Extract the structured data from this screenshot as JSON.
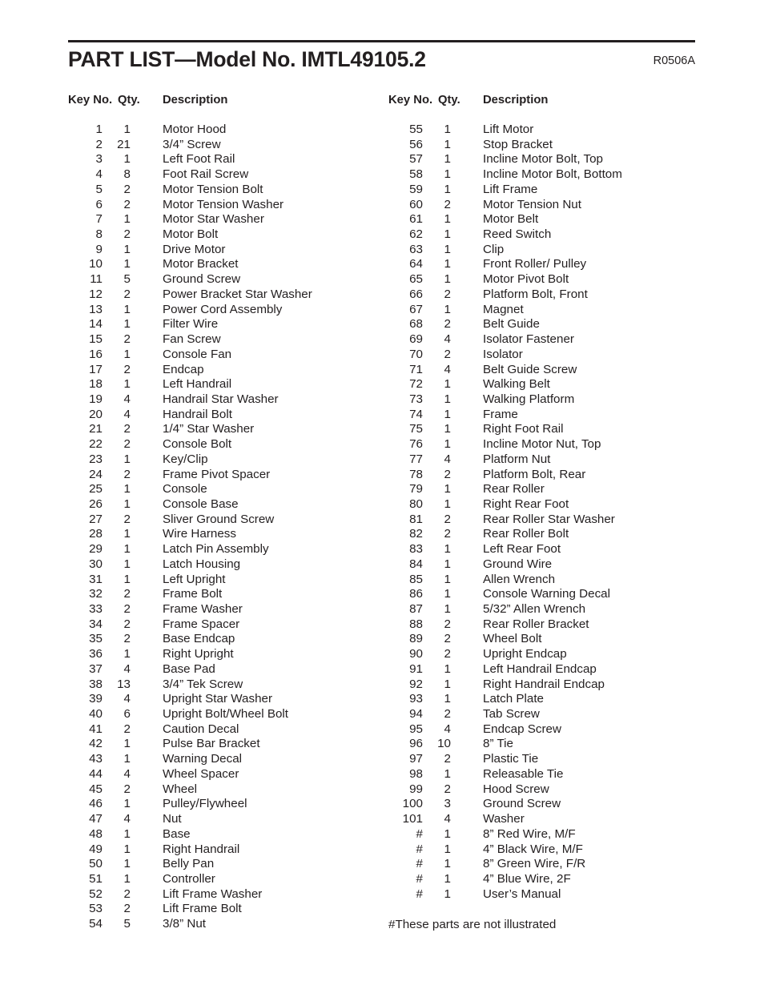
{
  "header": {
    "title": "PART LIST—Model No. IMTL49105.2",
    "revision": "R0506A"
  },
  "table": {
    "headers": {
      "key_no": "Key No.",
      "qty": "Qty.",
      "description": "Description"
    },
    "left_column": [
      {
        "key": "1",
        "qty": "1",
        "desc": "Motor Hood"
      },
      {
        "key": "2",
        "qty": "21",
        "desc": "3/4” Screw"
      },
      {
        "key": "3",
        "qty": "1",
        "desc": "Left Foot Rail"
      },
      {
        "key": "4",
        "qty": "8",
        "desc": "Foot Rail Screw"
      },
      {
        "key": "5",
        "qty": "2",
        "desc": "Motor Tension Bolt"
      },
      {
        "key": "6",
        "qty": "2",
        "desc": "Motor Tension Washer"
      },
      {
        "key": "7",
        "qty": "1",
        "desc": "Motor Star Washer"
      },
      {
        "key": "8",
        "qty": "2",
        "desc": "Motor Bolt"
      },
      {
        "key": "9",
        "qty": "1",
        "desc": "Drive Motor"
      },
      {
        "key": "10",
        "qty": "1",
        "desc": "Motor Bracket"
      },
      {
        "key": "11",
        "qty": "5",
        "desc": "Ground Screw"
      },
      {
        "key": "12",
        "qty": "2",
        "desc": "Power Bracket Star Washer"
      },
      {
        "key": "13",
        "qty": "1",
        "desc": "Power Cord Assembly"
      },
      {
        "key": "14",
        "qty": "1",
        "desc": "Filter Wire"
      },
      {
        "key": "15",
        "qty": "2",
        "desc": "Fan Screw"
      },
      {
        "key": "16",
        "qty": "1",
        "desc": "Console Fan"
      },
      {
        "key": "17",
        "qty": "2",
        "desc": "Endcap"
      },
      {
        "key": "18",
        "qty": "1",
        "desc": "Left Handrail"
      },
      {
        "key": "19",
        "qty": "4",
        "desc": "Handrail Star Washer"
      },
      {
        "key": "20",
        "qty": "4",
        "desc": "Handrail Bolt"
      },
      {
        "key": "21",
        "qty": "2",
        "desc": "1/4” Star Washer"
      },
      {
        "key": "22",
        "qty": "2",
        "desc": "Console Bolt"
      },
      {
        "key": "23",
        "qty": "1",
        "desc": "Key/Clip"
      },
      {
        "key": "24",
        "qty": "2",
        "desc": "Frame Pivot Spacer"
      },
      {
        "key": "25",
        "qty": "1",
        "desc": "Console"
      },
      {
        "key": "26",
        "qty": "1",
        "desc": "Console Base"
      },
      {
        "key": "27",
        "qty": "2",
        "desc": "Sliver Ground Screw"
      },
      {
        "key": "28",
        "qty": "1",
        "desc": "Wire Harness"
      },
      {
        "key": "29",
        "qty": "1",
        "desc": "Latch Pin Assembly"
      },
      {
        "key": "30",
        "qty": "1",
        "desc": "Latch Housing"
      },
      {
        "key": "31",
        "qty": "1",
        "desc": "Left Upright"
      },
      {
        "key": "32",
        "qty": "2",
        "desc": "Frame Bolt"
      },
      {
        "key": "33",
        "qty": "2",
        "desc": "Frame Washer"
      },
      {
        "key": "34",
        "qty": "2",
        "desc": "Frame Spacer"
      },
      {
        "key": "35",
        "qty": "2",
        "desc": "Base Endcap"
      },
      {
        "key": "36",
        "qty": "1",
        "desc": "Right Upright"
      },
      {
        "key": "37",
        "qty": "4",
        "desc": "Base Pad"
      },
      {
        "key": "38",
        "qty": "13",
        "desc": "3/4” Tek Screw"
      },
      {
        "key": "39",
        "qty": "4",
        "desc": "Upright Star Washer"
      },
      {
        "key": "40",
        "qty": "6",
        "desc": "Upright Bolt/Wheel Bolt"
      },
      {
        "key": "41",
        "qty": "2",
        "desc": "Caution Decal"
      },
      {
        "key": "42",
        "qty": "1",
        "desc": "Pulse Bar Bracket"
      },
      {
        "key": "43",
        "qty": "1",
        "desc": "Warning Decal"
      },
      {
        "key": "44",
        "qty": "4",
        "desc": "Wheel Spacer"
      },
      {
        "key": "45",
        "qty": "2",
        "desc": "Wheel"
      },
      {
        "key": "46",
        "qty": "1",
        "desc": "Pulley/Flywheel"
      },
      {
        "key": "47",
        "qty": "4",
        "desc": "Nut"
      },
      {
        "key": "48",
        "qty": "1",
        "desc": "Base"
      },
      {
        "key": "49",
        "qty": "1",
        "desc": "Right Handrail"
      },
      {
        "key": "50",
        "qty": "1",
        "desc": "Belly Pan"
      },
      {
        "key": "51",
        "qty": "1",
        "desc": "Controller"
      },
      {
        "key": "52",
        "qty": "2",
        "desc": "Lift Frame Washer"
      },
      {
        "key": "53",
        "qty": "2",
        "desc": "Lift Frame Bolt"
      },
      {
        "key": "54",
        "qty": "5",
        "desc": "3/8” Nut"
      }
    ],
    "right_column": [
      {
        "key": "55",
        "qty": "1",
        "desc": "Lift Motor"
      },
      {
        "key": "56",
        "qty": "1",
        "desc": "Stop Bracket"
      },
      {
        "key": "57",
        "qty": "1",
        "desc": "Incline Motor Bolt, Top"
      },
      {
        "key": "58",
        "qty": "1",
        "desc": "Incline Motor Bolt, Bottom"
      },
      {
        "key": "59",
        "qty": "1",
        "desc": "Lift Frame"
      },
      {
        "key": "60",
        "qty": "2",
        "desc": "Motor Tension Nut"
      },
      {
        "key": "61",
        "qty": "1",
        "desc": "Motor Belt"
      },
      {
        "key": "62",
        "qty": "1",
        "desc": "Reed Switch"
      },
      {
        "key": "63",
        "qty": "1",
        "desc": "Clip"
      },
      {
        "key": "64",
        "qty": "1",
        "desc": "Front Roller/ Pulley"
      },
      {
        "key": "65",
        "qty": "1",
        "desc": "Motor Pivot Bolt"
      },
      {
        "key": "66",
        "qty": "2",
        "desc": "Platform Bolt, Front"
      },
      {
        "key": "67",
        "qty": "1",
        "desc": "Magnet"
      },
      {
        "key": "68",
        "qty": "2",
        "desc": "Belt Guide"
      },
      {
        "key": "69",
        "qty": "4",
        "desc": "Isolator Fastener"
      },
      {
        "key": "70",
        "qty": "2",
        "desc": "Isolator"
      },
      {
        "key": "71",
        "qty": "4",
        "desc": "Belt Guide Screw"
      },
      {
        "key": "72",
        "qty": "1",
        "desc": "Walking Belt"
      },
      {
        "key": "73",
        "qty": "1",
        "desc": "Walking Platform"
      },
      {
        "key": "74",
        "qty": "1",
        "desc": "Frame"
      },
      {
        "key": "75",
        "qty": "1",
        "desc": "Right Foot Rail"
      },
      {
        "key": "76",
        "qty": "1",
        "desc": "Incline Motor Nut, Top"
      },
      {
        "key": "77",
        "qty": "4",
        "desc": "Platform Nut"
      },
      {
        "key": "78",
        "qty": "2",
        "desc": "Platform Bolt, Rear"
      },
      {
        "key": "79",
        "qty": "1",
        "desc": "Rear Roller"
      },
      {
        "key": "80",
        "qty": "1",
        "desc": "Right Rear Foot"
      },
      {
        "key": "81",
        "qty": "2",
        "desc": "Rear Roller Star Washer"
      },
      {
        "key": "82",
        "qty": "2",
        "desc": "Rear Roller Bolt"
      },
      {
        "key": "83",
        "qty": "1",
        "desc": "Left Rear Foot"
      },
      {
        "key": "84",
        "qty": "1",
        "desc": "Ground Wire"
      },
      {
        "key": "85",
        "qty": "1",
        "desc": "Allen Wrench"
      },
      {
        "key": "86",
        "qty": "1",
        "desc": "Console Warning Decal"
      },
      {
        "key": "87",
        "qty": "1",
        "desc": "5/32” Allen Wrench"
      },
      {
        "key": "88",
        "qty": "2",
        "desc": "Rear Roller Bracket"
      },
      {
        "key": "89",
        "qty": "2",
        "desc": "Wheel Bolt"
      },
      {
        "key": "90",
        "qty": "2",
        "desc": "Upright Endcap"
      },
      {
        "key": "91",
        "qty": "1",
        "desc": "Left Handrail Endcap"
      },
      {
        "key": "92",
        "qty": "1",
        "desc": "Right Handrail Endcap"
      },
      {
        "key": "93",
        "qty": "1",
        "desc": "Latch Plate"
      },
      {
        "key": "94",
        "qty": "2",
        "desc": "Tab Screw"
      },
      {
        "key": "95",
        "qty": "4",
        "desc": "Endcap Screw"
      },
      {
        "key": "96",
        "qty": "10",
        "desc": "8” Tie"
      },
      {
        "key": "97",
        "qty": "2",
        "desc": "Plastic Tie"
      },
      {
        "key": "98",
        "qty": "1",
        "desc": "Releasable Tie"
      },
      {
        "key": "99",
        "qty": "2",
        "desc": "Hood Screw"
      },
      {
        "key": "100",
        "qty": "3",
        "desc": "Ground Screw"
      },
      {
        "key": "101",
        "qty": "4",
        "desc": "Washer"
      },
      {
        "key": "#",
        "qty": "1",
        "desc": "8” Red Wire, M/F"
      },
      {
        "key": "#",
        "qty": "1",
        "desc": "4” Black Wire, M/F"
      },
      {
        "key": "#",
        "qty": "1",
        "desc": "8” Green Wire, F/R"
      },
      {
        "key": "#",
        "qty": "1",
        "desc": "4” Blue Wire, 2F"
      },
      {
        "key": "#",
        "qty": "1",
        "desc": "User’s Manual"
      }
    ]
  },
  "footnote": "#These parts are not illustrated"
}
